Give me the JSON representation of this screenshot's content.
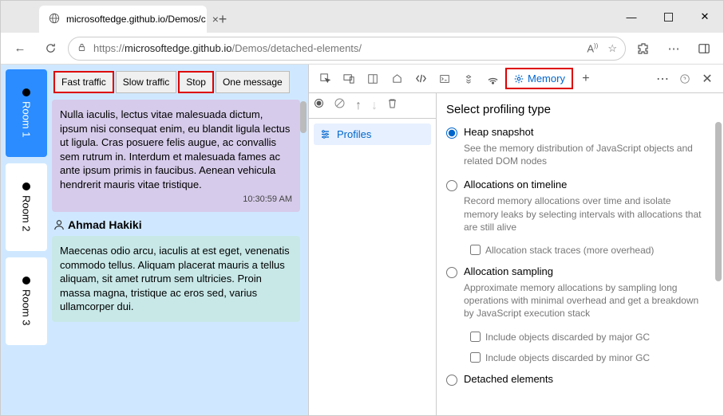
{
  "browser": {
    "tab_title": "microsoftedge.github.io/Demos/c",
    "url_host": "microsoftedge.github.io",
    "url_path": "/Demos/detached-elements/",
    "url_prefix": "https://"
  },
  "rooms": [
    "Room 1",
    "Room 2",
    "Room 3"
  ],
  "buttons": {
    "fast": "Fast traffic",
    "slow": "Slow traffic",
    "stop": "Stop",
    "one": "One message"
  },
  "messages": [
    {
      "body": "Nulla iaculis, lectus vitae malesuada dictum, ipsum nisi consequat enim, eu blandit ligula lectus ut ligula. Cras posuere felis augue, ac convallis sem rutrum in. Interdum et malesuada fames ac ante ipsum primis in faucibus. Aenean vehicula hendrerit mauris vitae tristique.",
      "time": "10:30:59 AM"
    },
    {
      "user": "Ahmad Hakiki",
      "body": "Maecenas odio arcu, iaculis at est eget, venenatis commodo tellus. Aliquam placerat mauris a tellus aliquam, sit amet rutrum sem ultricies. Proin massa magna, tristique ac eros sed, varius ullamcorper dui."
    }
  ],
  "devtools": {
    "memory_tab": "Memory",
    "profiles": "Profiles",
    "heading": "Select profiling type",
    "opts": [
      {
        "label": "Heap snapshot",
        "desc": "See the memory distribution of JavaScript objects and related DOM nodes"
      },
      {
        "label": "Allocations on timeline",
        "desc": "Record memory allocations over time and isolate memory leaks by selecting intervals with allocations that are still alive"
      },
      {
        "label": "Allocation sampling",
        "desc": "Approximate memory allocations by sampling long operations with minimal overhead and get a breakdown by JavaScript execution stack"
      },
      {
        "label": "Detached elements"
      }
    ],
    "sub": {
      "stack": "Allocation stack traces (more overhead)",
      "major": "Include objects discarded by major GC",
      "minor": "Include objects discarded by minor GC"
    }
  }
}
